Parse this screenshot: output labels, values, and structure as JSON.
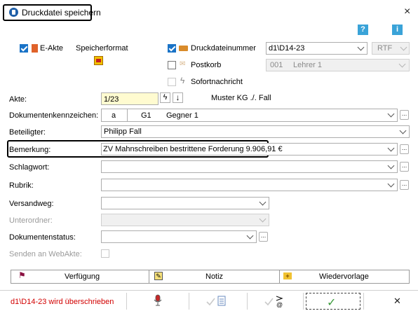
{
  "window": {
    "title": "Druckdatei speichern",
    "close": "×"
  },
  "help": {
    "help_label": "?",
    "info_label": "i"
  },
  "options": {
    "eakte_label": "E-Akte",
    "speicherformat_label": "Speicherformat",
    "druckdateinummer_label": "Druckdateinummer",
    "druckdateinummer_value": "d1\\D14-23",
    "format_value": "RTF",
    "postkorb_label": "Postkorb",
    "postkorb_number": "001",
    "postkorb_user": "Lehrer 1",
    "sofortnachricht_label": "Sofortnachricht"
  },
  "form": {
    "akte_label": "Akte:",
    "akte_value": "1/23",
    "akte_name": "Muster KG ./. Fall",
    "doc_label": "Dokumentenkennzeichen:",
    "doc_code": "a",
    "doc_g": "G1",
    "doc_name": "Gegner 1",
    "beteiligter_label": "Beteiligter:",
    "beteiligter_value": "Philipp Fall",
    "bemerkung_label": "Bemerkung:",
    "bemerkung_value": "ZV Mahnschreiben bestrittene Forderung 9.906,91 €",
    "schlagwort_label": "Schlagwort:",
    "rubrik_label": "Rubrik:",
    "versandweg_label": "Versandweg:",
    "unterordner_label": "Unterordner:",
    "dokumentenstatus_label": "Dokumentenstatus:",
    "webakte_label": "Senden an WebAkte:"
  },
  "actions": {
    "verfuegung_label": "Verfügung",
    "notiz_label": "Notiz",
    "wiedervorlage_label": "Wiedervorlage"
  },
  "footer": {
    "status_text": "d1\\D14-23 wird überschrieben",
    "ok_symbol": "✓",
    "cancel_symbol": "✕"
  },
  "colors": {
    "status_red": "#d20000",
    "accent_blue": "#1a73c7",
    "akte_yellow": "#fffbd0"
  }
}
